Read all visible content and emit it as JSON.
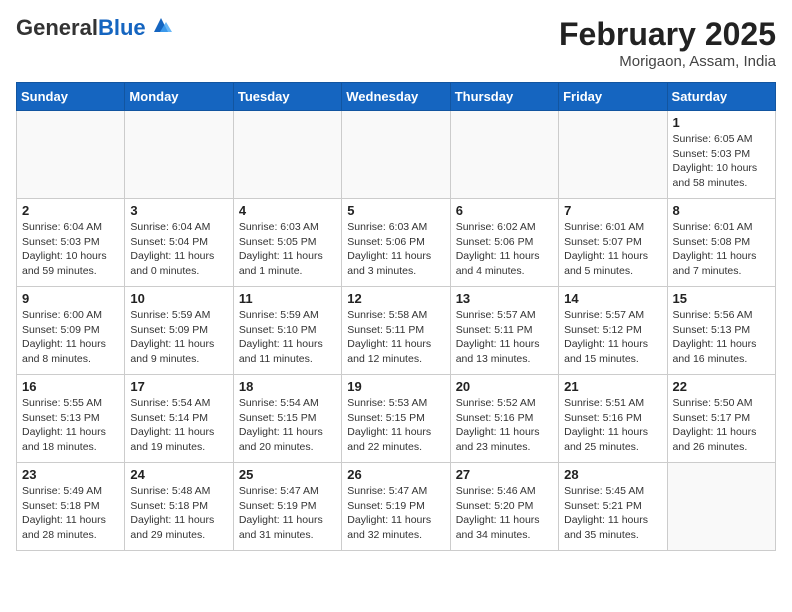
{
  "header": {
    "logo_general": "General",
    "logo_blue": "Blue",
    "month_title": "February 2025",
    "location": "Morigaon, Assam, India"
  },
  "weekdays": [
    "Sunday",
    "Monday",
    "Tuesday",
    "Wednesday",
    "Thursday",
    "Friday",
    "Saturday"
  ],
  "weeks": [
    [
      {
        "day": "",
        "info": ""
      },
      {
        "day": "",
        "info": ""
      },
      {
        "day": "",
        "info": ""
      },
      {
        "day": "",
        "info": ""
      },
      {
        "day": "",
        "info": ""
      },
      {
        "day": "",
        "info": ""
      },
      {
        "day": "1",
        "info": "Sunrise: 6:05 AM\nSunset: 5:03 PM\nDaylight: 10 hours and 58 minutes."
      }
    ],
    [
      {
        "day": "2",
        "info": "Sunrise: 6:04 AM\nSunset: 5:03 PM\nDaylight: 10 hours and 59 minutes."
      },
      {
        "day": "3",
        "info": "Sunrise: 6:04 AM\nSunset: 5:04 PM\nDaylight: 11 hours and 0 minutes."
      },
      {
        "day": "4",
        "info": "Sunrise: 6:03 AM\nSunset: 5:05 PM\nDaylight: 11 hours and 1 minute."
      },
      {
        "day": "5",
        "info": "Sunrise: 6:03 AM\nSunset: 5:06 PM\nDaylight: 11 hours and 3 minutes."
      },
      {
        "day": "6",
        "info": "Sunrise: 6:02 AM\nSunset: 5:06 PM\nDaylight: 11 hours and 4 minutes."
      },
      {
        "day": "7",
        "info": "Sunrise: 6:01 AM\nSunset: 5:07 PM\nDaylight: 11 hours and 5 minutes."
      },
      {
        "day": "8",
        "info": "Sunrise: 6:01 AM\nSunset: 5:08 PM\nDaylight: 11 hours and 7 minutes."
      }
    ],
    [
      {
        "day": "9",
        "info": "Sunrise: 6:00 AM\nSunset: 5:09 PM\nDaylight: 11 hours and 8 minutes."
      },
      {
        "day": "10",
        "info": "Sunrise: 5:59 AM\nSunset: 5:09 PM\nDaylight: 11 hours and 9 minutes."
      },
      {
        "day": "11",
        "info": "Sunrise: 5:59 AM\nSunset: 5:10 PM\nDaylight: 11 hours and 11 minutes."
      },
      {
        "day": "12",
        "info": "Sunrise: 5:58 AM\nSunset: 5:11 PM\nDaylight: 11 hours and 12 minutes."
      },
      {
        "day": "13",
        "info": "Sunrise: 5:57 AM\nSunset: 5:11 PM\nDaylight: 11 hours and 13 minutes."
      },
      {
        "day": "14",
        "info": "Sunrise: 5:57 AM\nSunset: 5:12 PM\nDaylight: 11 hours and 15 minutes."
      },
      {
        "day": "15",
        "info": "Sunrise: 5:56 AM\nSunset: 5:13 PM\nDaylight: 11 hours and 16 minutes."
      }
    ],
    [
      {
        "day": "16",
        "info": "Sunrise: 5:55 AM\nSunset: 5:13 PM\nDaylight: 11 hours and 18 minutes."
      },
      {
        "day": "17",
        "info": "Sunrise: 5:54 AM\nSunset: 5:14 PM\nDaylight: 11 hours and 19 minutes."
      },
      {
        "day": "18",
        "info": "Sunrise: 5:54 AM\nSunset: 5:15 PM\nDaylight: 11 hours and 20 minutes."
      },
      {
        "day": "19",
        "info": "Sunrise: 5:53 AM\nSunset: 5:15 PM\nDaylight: 11 hours and 22 minutes."
      },
      {
        "day": "20",
        "info": "Sunrise: 5:52 AM\nSunset: 5:16 PM\nDaylight: 11 hours and 23 minutes."
      },
      {
        "day": "21",
        "info": "Sunrise: 5:51 AM\nSunset: 5:16 PM\nDaylight: 11 hours and 25 minutes."
      },
      {
        "day": "22",
        "info": "Sunrise: 5:50 AM\nSunset: 5:17 PM\nDaylight: 11 hours and 26 minutes."
      }
    ],
    [
      {
        "day": "23",
        "info": "Sunrise: 5:49 AM\nSunset: 5:18 PM\nDaylight: 11 hours and 28 minutes."
      },
      {
        "day": "24",
        "info": "Sunrise: 5:48 AM\nSunset: 5:18 PM\nDaylight: 11 hours and 29 minutes."
      },
      {
        "day": "25",
        "info": "Sunrise: 5:47 AM\nSunset: 5:19 PM\nDaylight: 11 hours and 31 minutes."
      },
      {
        "day": "26",
        "info": "Sunrise: 5:47 AM\nSunset: 5:19 PM\nDaylight: 11 hours and 32 minutes."
      },
      {
        "day": "27",
        "info": "Sunrise: 5:46 AM\nSunset: 5:20 PM\nDaylight: 11 hours and 34 minutes."
      },
      {
        "day": "28",
        "info": "Sunrise: 5:45 AM\nSunset: 5:21 PM\nDaylight: 11 hours and 35 minutes."
      },
      {
        "day": "",
        "info": ""
      }
    ]
  ]
}
